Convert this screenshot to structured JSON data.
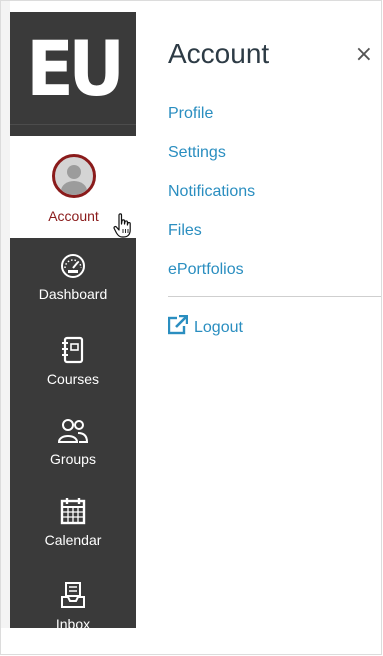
{
  "sidebar": {
    "logo_text": "EU",
    "items": [
      {
        "label": "Account",
        "icon": "user-avatar-icon",
        "active": true
      },
      {
        "label": "Dashboard",
        "icon": "speedometer-icon"
      },
      {
        "label": "Courses",
        "icon": "notebook-icon"
      },
      {
        "label": "Groups",
        "icon": "groups-icon"
      },
      {
        "label": "Calendar",
        "icon": "calendar-icon"
      },
      {
        "label": "Inbox",
        "icon": "inbox-icon"
      }
    ]
  },
  "tray": {
    "title": "Account",
    "close_label": "×",
    "links": [
      {
        "label": "Profile"
      },
      {
        "label": "Settings"
      },
      {
        "label": "Notifications"
      },
      {
        "label": "Files"
      },
      {
        "label": "ePortfolios"
      }
    ],
    "logout_label": "Logout"
  },
  "colors": {
    "sidebar_bg": "#3a3a3a",
    "accent_red": "#8a1b1b",
    "link_blue": "#2a8ec0",
    "title_text": "#2d3b45"
  }
}
